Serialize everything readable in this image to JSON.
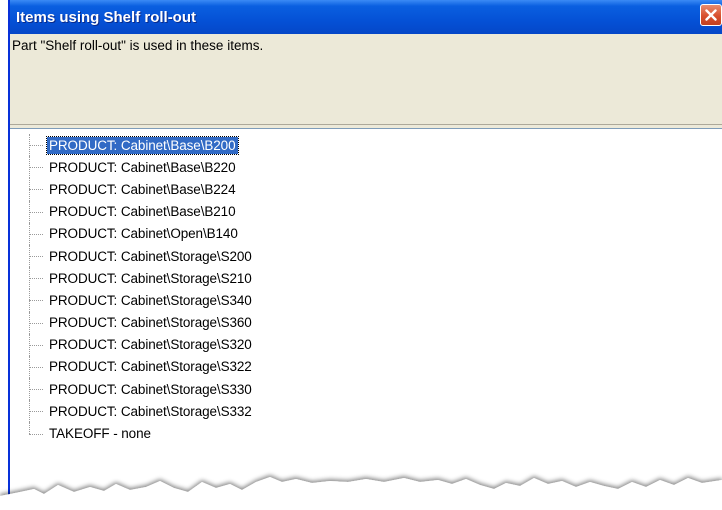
{
  "window": {
    "title": "Items using Shelf roll-out",
    "close_icon": "close-icon"
  },
  "info": {
    "message": "Part \"Shelf roll-out\" is used in these items."
  },
  "tree": {
    "items": [
      {
        "label": "PRODUCT: Cabinet\\Base\\B200",
        "selected": true
      },
      {
        "label": "PRODUCT: Cabinet\\Base\\B220"
      },
      {
        "label": "PRODUCT: Cabinet\\Base\\B224"
      },
      {
        "label": "PRODUCT: Cabinet\\Base\\B210"
      },
      {
        "label": "PRODUCT: Cabinet\\Open\\B140"
      },
      {
        "label": "PRODUCT: Cabinet\\Storage\\S200"
      },
      {
        "label": "PRODUCT: Cabinet\\Storage\\S210"
      },
      {
        "label": "PRODUCT: Cabinet\\Storage\\S340"
      },
      {
        "label": "PRODUCT: Cabinet\\Storage\\S360"
      },
      {
        "label": "PRODUCT: Cabinet\\Storage\\S320"
      },
      {
        "label": "PRODUCT: Cabinet\\Storage\\S322"
      },
      {
        "label": "PRODUCT: Cabinet\\Storage\\S330"
      },
      {
        "label": "PRODUCT: Cabinet\\Storage\\S332"
      },
      {
        "label": "TAKEOFF - none"
      }
    ]
  },
  "colors": {
    "titlebar": "#0551d6",
    "selection": "#316ac5",
    "dialog_face": "#ece9d8",
    "close_button": "#d8502e"
  }
}
